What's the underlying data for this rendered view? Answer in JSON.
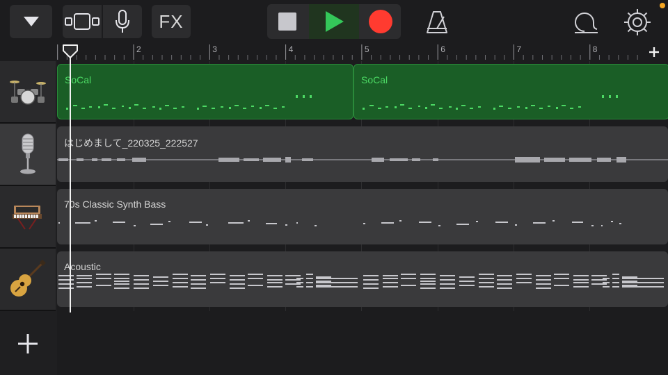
{
  "toolbar": {
    "fx_label": "FX",
    "icons": [
      "menu-down-icon",
      "track-view-icon",
      "microphone-icon",
      "stop-icon",
      "play-icon",
      "record-icon",
      "metronome-icon",
      "loop-icon",
      "settings-icon"
    ],
    "colors": {
      "play": "#34c759",
      "record": "#ff3b30",
      "stop": "#c7c7cc",
      "notification": "#f5a623"
    }
  },
  "ruler": {
    "bars": [
      "2",
      "3",
      "4",
      "5",
      "6",
      "7",
      "8"
    ]
  },
  "tracks": [
    {
      "instrument_icon": "drum-kit-icon",
      "regions": [
        "SoCal",
        "SoCal"
      ],
      "color": "#1a5e26"
    },
    {
      "instrument_icon": "microphone-icon",
      "regions": [
        "はじめまして_220325_222527"
      ],
      "color": "#3a3a3c"
    },
    {
      "instrument_icon": "synthesizer-icon",
      "regions": [
        "70s Classic Synth Bass"
      ],
      "color": "#3a3a3c"
    },
    {
      "instrument_icon": "acoustic-guitar-icon",
      "regions": [
        "Acoustic"
      ],
      "color": "#3a3a3c"
    }
  ]
}
